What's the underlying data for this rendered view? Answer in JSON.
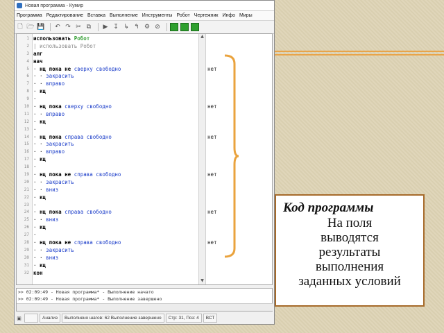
{
  "window": {
    "title": "Новая программа - Кумир",
    "menu": [
      "Программа",
      "Редактирование",
      "Вставка",
      "Выполнение",
      "Инструменты",
      "Робот",
      "Чертежник",
      "Инфо",
      "Миры"
    ]
  },
  "editor": {
    "lines": [
      {
        "n": "1",
        "segs": [
          {
            "t": "использовать ",
            "c": "kw"
          },
          {
            "t": "Робот",
            "c": "gr"
          }
        ],
        "margin": ""
      },
      {
        "n": "2",
        "segs": [
          {
            "t": "| использовать Робот",
            "c": "gy"
          }
        ],
        "margin": ""
      },
      {
        "n": "3",
        "segs": [
          {
            "t": "алг",
            "c": "kw"
          }
        ],
        "margin": ""
      },
      {
        "n": "4",
        "segs": [
          {
            "t": "нач",
            "c": "kw"
          }
        ],
        "margin": ""
      },
      {
        "n": "5",
        "segs": [
          {
            "t": "· ",
            "c": ""
          },
          {
            "t": "нц пока не ",
            "c": "kw"
          },
          {
            "t": "сверху свободно",
            "c": "bl"
          }
        ],
        "margin": "нет"
      },
      {
        "n": "6",
        "segs": [
          {
            "t": "· · ",
            "c": ""
          },
          {
            "t": "закрасить",
            "c": "bl"
          }
        ],
        "margin": ""
      },
      {
        "n": "7",
        "segs": [
          {
            "t": "· · ",
            "c": ""
          },
          {
            "t": "вправо",
            "c": "bl"
          }
        ],
        "margin": ""
      },
      {
        "n": "8",
        "segs": [
          {
            "t": "· ",
            "c": ""
          },
          {
            "t": "кц",
            "c": "kw"
          }
        ],
        "margin": ""
      },
      {
        "n": "9",
        "segs": [
          {
            "t": "·",
            "c": ""
          }
        ],
        "margin": ""
      },
      {
        "n": "10",
        "segs": [
          {
            "t": "· ",
            "c": ""
          },
          {
            "t": "нц пока ",
            "c": "kw"
          },
          {
            "t": "сверху свободно",
            "c": "bl"
          }
        ],
        "margin": "нет"
      },
      {
        "n": "11",
        "segs": [
          {
            "t": "· · ",
            "c": ""
          },
          {
            "t": "вправо",
            "c": "bl"
          }
        ],
        "margin": ""
      },
      {
        "n": "12",
        "segs": [
          {
            "t": "· ",
            "c": ""
          },
          {
            "t": "кц",
            "c": "kw"
          }
        ],
        "margin": ""
      },
      {
        "n": "13",
        "segs": [
          {
            "t": "·",
            "c": ""
          }
        ],
        "margin": ""
      },
      {
        "n": "14",
        "segs": [
          {
            "t": "· ",
            "c": ""
          },
          {
            "t": "нц пока ",
            "c": "kw"
          },
          {
            "t": "справа свободно",
            "c": "bl"
          }
        ],
        "margin": "нет"
      },
      {
        "n": "15",
        "segs": [
          {
            "t": "· · ",
            "c": ""
          },
          {
            "t": "закрасить",
            "c": "bl"
          }
        ],
        "margin": ""
      },
      {
        "n": "16",
        "segs": [
          {
            "t": "· · ",
            "c": ""
          },
          {
            "t": "вправо",
            "c": "bl"
          }
        ],
        "margin": ""
      },
      {
        "n": "17",
        "segs": [
          {
            "t": "· ",
            "c": ""
          },
          {
            "t": "кц",
            "c": "kw"
          }
        ],
        "margin": ""
      },
      {
        "n": "18",
        "segs": [
          {
            "t": "·",
            "c": ""
          }
        ],
        "margin": ""
      },
      {
        "n": "19",
        "segs": [
          {
            "t": "· ",
            "c": ""
          },
          {
            "t": "нц пока не ",
            "c": "kw"
          },
          {
            "t": "справа свободно",
            "c": "bl"
          }
        ],
        "margin": "нет"
      },
      {
        "n": "20",
        "segs": [
          {
            "t": "· · ",
            "c": ""
          },
          {
            "t": "закрасить",
            "c": "bl"
          }
        ],
        "margin": ""
      },
      {
        "n": "21",
        "segs": [
          {
            "t": "· · ",
            "c": ""
          },
          {
            "t": "вниз",
            "c": "bl"
          }
        ],
        "margin": ""
      },
      {
        "n": "22",
        "segs": [
          {
            "t": "· ",
            "c": ""
          },
          {
            "t": "кц",
            "c": "kw"
          }
        ],
        "margin": ""
      },
      {
        "n": "23",
        "segs": [
          {
            "t": "·",
            "c": ""
          }
        ],
        "margin": ""
      },
      {
        "n": "24",
        "segs": [
          {
            "t": "· ",
            "c": ""
          },
          {
            "t": "нц пока ",
            "c": "kw"
          },
          {
            "t": "справа свободно",
            "c": "bl"
          }
        ],
        "margin": "нет"
      },
      {
        "n": "25",
        "segs": [
          {
            "t": "· · ",
            "c": ""
          },
          {
            "t": "вниз",
            "c": "bl"
          }
        ],
        "margin": ""
      },
      {
        "n": "26",
        "segs": [
          {
            "t": "· ",
            "c": ""
          },
          {
            "t": "кц",
            "c": "kw"
          }
        ],
        "margin": ""
      },
      {
        "n": "27",
        "segs": [
          {
            "t": "·",
            "c": ""
          }
        ],
        "margin": ""
      },
      {
        "n": "28",
        "segs": [
          {
            "t": "· ",
            "c": ""
          },
          {
            "t": "нц пока не ",
            "c": "kw"
          },
          {
            "t": "справа свободно",
            "c": "bl"
          }
        ],
        "margin": "нет"
      },
      {
        "n": "29",
        "segs": [
          {
            "t": "· · ",
            "c": ""
          },
          {
            "t": "закрасить",
            "c": "bl"
          }
        ],
        "margin": ""
      },
      {
        "n": "30",
        "segs": [
          {
            "t": "· · ",
            "c": ""
          },
          {
            "t": "вниз",
            "c": "bl"
          }
        ],
        "margin": ""
      },
      {
        "n": "31",
        "segs": [
          {
            "t": "· ",
            "c": ""
          },
          {
            "t": "кц",
            "c": "kw"
          }
        ],
        "margin": ""
      },
      {
        "n": "32",
        "segs": [
          {
            "t": "кон",
            "c": "kw"
          }
        ],
        "margin": ""
      }
    ]
  },
  "console": {
    "lines": [
      ">> 02:09:49 - Новая программа* - Выполнение начато",
      ">> 02:09:49 - Новая программа* - Выполнение завершено"
    ]
  },
  "status": {
    "mode": "Анализ",
    "steps": "Выполнено шагов: 62 Выполнение завершено",
    "position": "Стр: 31, Поз: 4",
    "insert": "ВСТ"
  },
  "callout": {
    "title": "Код программы",
    "body_lines": [
      "На поля",
      "выводятся",
      "результаты",
      "выполнения",
      "заданных условий"
    ]
  },
  "colors": {
    "accent_orange": "#e8a449",
    "bracket": "#eaa33e",
    "keyword_blue": "#1a3cc9",
    "robot_green": "#3aa23a",
    "callout_border": "#a66a2a"
  }
}
